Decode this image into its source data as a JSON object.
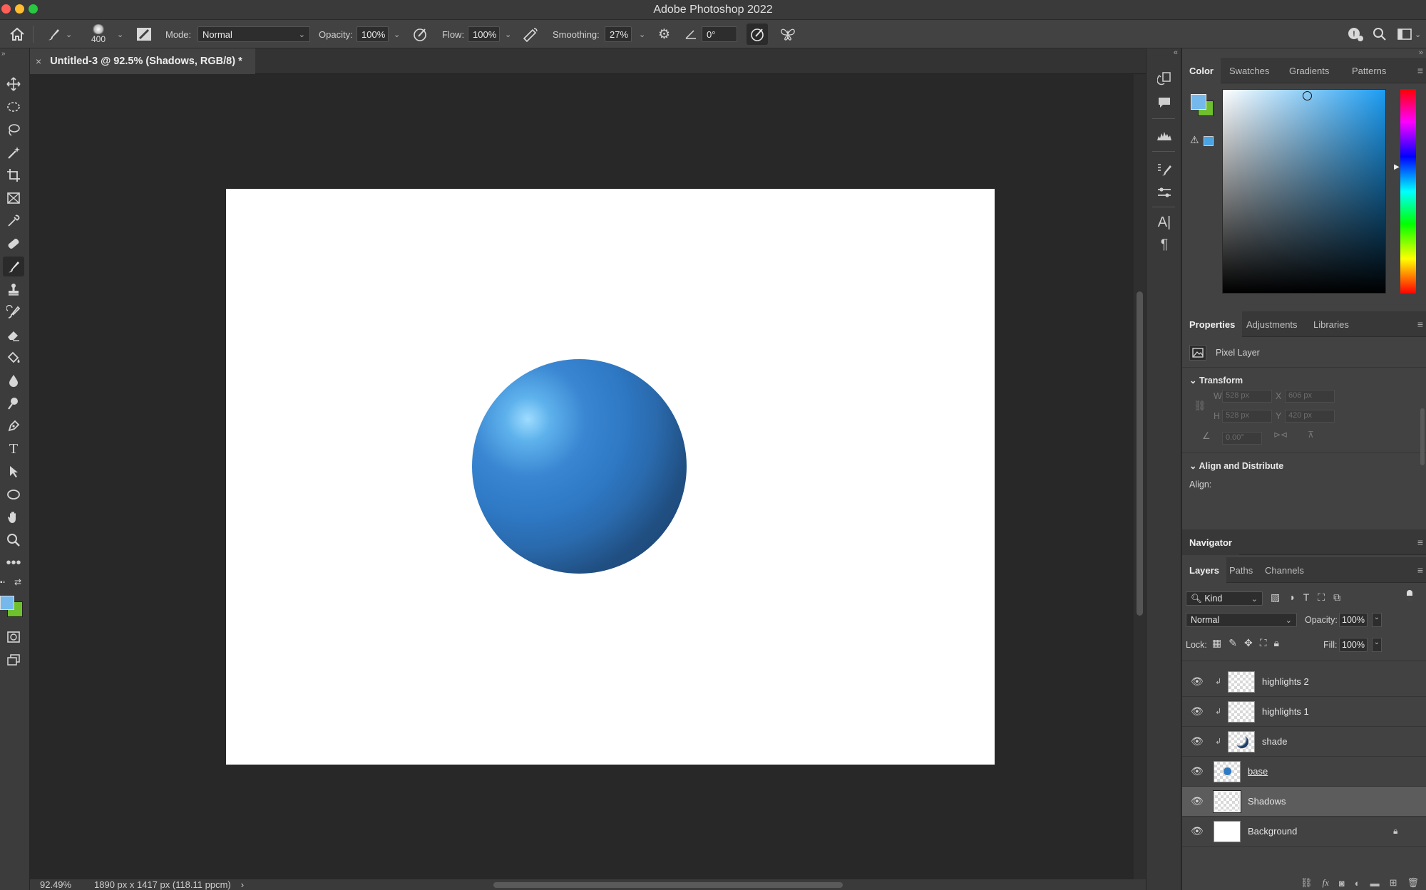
{
  "window": {
    "title": "Adobe Photoshop 2022",
    "traffic_lights": [
      "#ff5f57",
      "#febc2e",
      "#28c840"
    ]
  },
  "options_bar": {
    "brush_size": "400",
    "mode_label": "Mode:",
    "mode_value": "Normal",
    "opacity_label": "Opacity:",
    "opacity_value": "100%",
    "flow_label": "Flow:",
    "flow_value": "100%",
    "smoothing_label": "Smoothing:",
    "smoothing_value": "27%",
    "angle_value": "0°"
  },
  "document": {
    "tab_title": "Untitled-3 @ 92.5% (Shadows, RGB/8) *",
    "close_glyph": "×",
    "canvas_background": "#ffffff"
  },
  "status_bar": {
    "zoom": "92.49%",
    "doc_info": "1890 px x 1417 px (118.11 ppcm)",
    "arrow": "›"
  },
  "tools": [
    "move-tool",
    "marquee-tool",
    "lasso-tool",
    "magic-wand-tool",
    "crop-tool",
    "frame-tool",
    "eyedropper-tool",
    "healing-brush-tool",
    "brush-tool",
    "clone-stamp-tool",
    "history-brush-tool",
    "eraser-tool",
    "paint-bucket-tool",
    "blur-tool",
    "dodge-tool",
    "pen-tool",
    "type-tool",
    "path-selection-tool",
    "ellipse-tool",
    "hand-tool",
    "zoom-tool",
    "more-tools"
  ],
  "colors": {
    "foreground": "#74b8ec",
    "background": "#6fbf2e",
    "accent_blue": "#2f7ac4"
  },
  "color_panel": {
    "tabs": [
      "Color",
      "Swatches",
      "Gradients",
      "Patterns"
    ],
    "active_tab": "Color"
  },
  "properties_panel": {
    "tabs": [
      "Properties",
      "Adjustments",
      "Libraries"
    ],
    "layer_kind": "Pixel Layer",
    "transform_title": "Transform",
    "w_label": "W",
    "w_value": "528 px",
    "h_label": "H",
    "h_value": "528 px",
    "x_label": "X",
    "x_value": "606 px",
    "y_label": "Y",
    "y_value": "420 px",
    "angle_value": "0.00°",
    "align_title": "Align and Distribute",
    "align_label": "Align:"
  },
  "navigator_panel": {
    "title": "Navigator"
  },
  "layers_panel": {
    "tabs": [
      "Layers",
      "Paths",
      "Channels"
    ],
    "filter_kind": "Kind",
    "blend_mode": "Normal",
    "opacity_label": "Opacity:",
    "opacity_value": "100%",
    "lock_label": "Lock:",
    "fill_label": "Fill:",
    "fill_value": "100%",
    "layers": [
      {
        "name": "highlights 2",
        "clipped": true,
        "selected": false
      },
      {
        "name": "highlights 1",
        "clipped": true,
        "selected": false
      },
      {
        "name": "shade",
        "clipped": true,
        "selected": false
      },
      {
        "name": "base",
        "clipped": false,
        "selected": false
      },
      {
        "name": "Shadows",
        "clipped": false,
        "selected": true
      },
      {
        "name": "Background",
        "clipped": false,
        "selected": false,
        "locked": true
      }
    ],
    "footer_fx": "fx"
  }
}
